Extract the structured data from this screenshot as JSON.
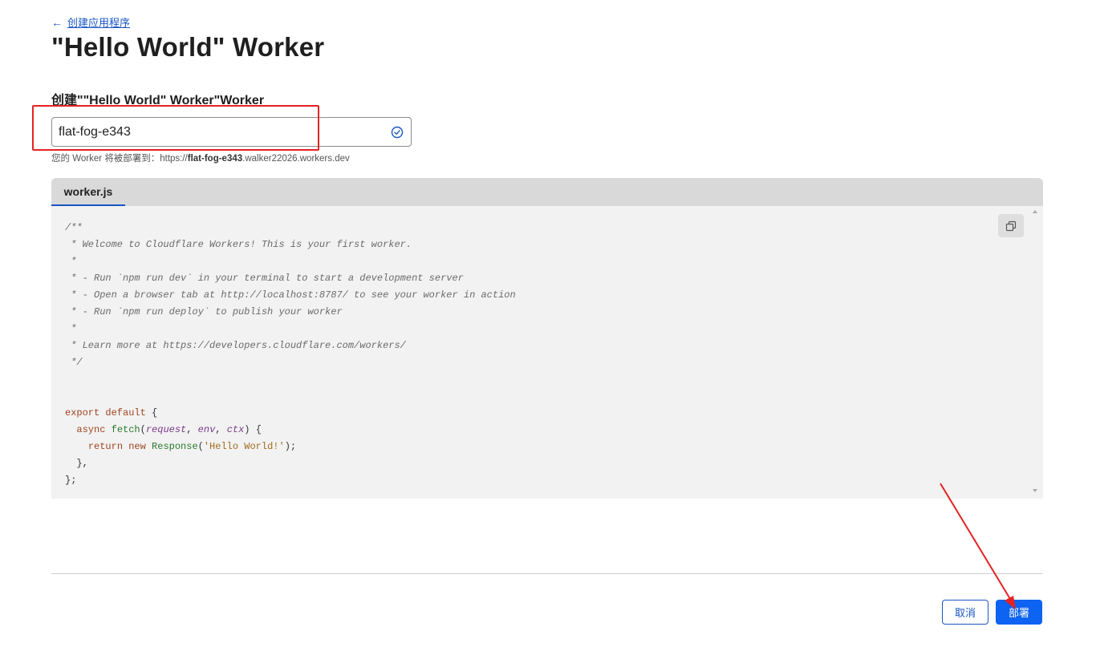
{
  "nav": {
    "back_label": "创建应用程序"
  },
  "header": {
    "title": "\"Hello World\" Worker"
  },
  "form": {
    "name_label": "创建\"\"Hello World\" Worker\"Worker",
    "name_value": "flat-fog-e343",
    "hint_prefix": "您的 Worker 将被部署到：https://",
    "hint_subdomain": "flat-fog-e343",
    "hint_suffix": ".walker22026.workers.dev"
  },
  "editor": {
    "tab_label": "worker.js",
    "code": {
      "c1": "/**",
      "c2": " * Welcome to Cloudflare Workers! This is your first worker.",
      "c3": " *",
      "c4": " * - Run `npm run dev` in your terminal to start a development server",
      "c5": " * - Open a browser tab at http://localhost:8787/ to see your worker in action",
      "c6": " * - Run `npm run deploy` to publish your worker",
      "c7": " *",
      "c8": " * Learn more at https://developers.cloudflare.com/workers/",
      "c9": " */",
      "l1_kw": "export default",
      "l1_rest": " {",
      "l2_kw": "async",
      "l2_fn": "fetch",
      "l2_open": "(",
      "l2_p1": "request",
      "l2_p2": "env",
      "l2_p3": "ctx",
      "l2_close": ") {",
      "l3_kw1": "return",
      "l3_kw2": "new",
      "l3_fn": "Response",
      "l3_str": "'Hello World!'",
      "l4": "  },",
      "l5": "};"
    }
  },
  "footer": {
    "cancel_label": "取消",
    "deploy_label": "部署"
  },
  "colors": {
    "accent": "#0d63f2",
    "link": "#1a56c4",
    "annotation": "#e52222"
  },
  "icons": {
    "back": "arrow-left-icon",
    "valid": "check-circle-icon",
    "copy": "copy-icon"
  }
}
